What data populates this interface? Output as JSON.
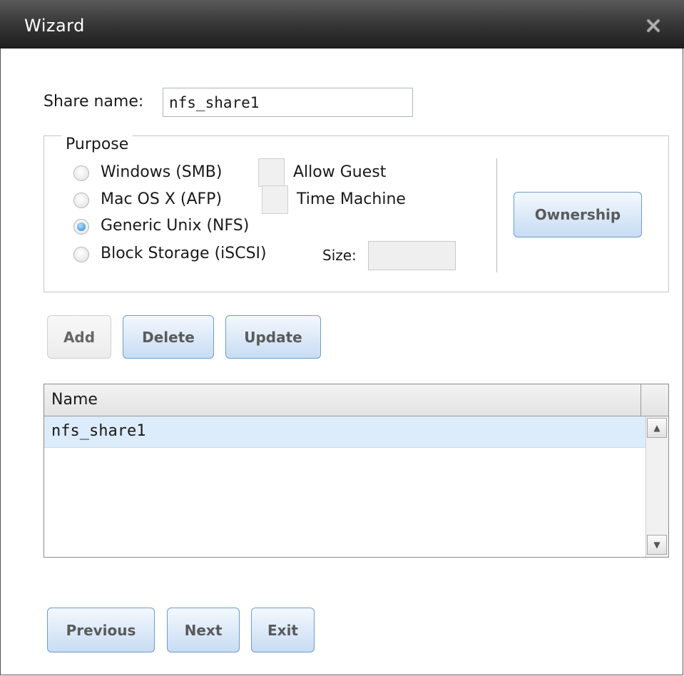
{
  "window": {
    "title": "Wizard",
    "close_icon": "close-x-icon"
  },
  "share": {
    "label": "Share name:",
    "value": "nfs_share1"
  },
  "purpose": {
    "legend": "Purpose",
    "options": [
      {
        "label": "Windows (SMB)",
        "checked": false,
        "extra_label": "Allow Guest"
      },
      {
        "label": "Mac OS X (AFP)",
        "checked": false,
        "extra_label": "Time Machine"
      },
      {
        "label": "Generic Unix (NFS)",
        "checked": true
      },
      {
        "label": "Block Storage (iSCSI)",
        "checked": false,
        "extra_label": "Size:"
      }
    ],
    "size_value": "",
    "ownership_label": "Ownership"
  },
  "actions": {
    "add": "Add",
    "delete": "Delete",
    "update": "Update"
  },
  "grid": {
    "columns": [
      "Name"
    ],
    "rows": [
      {
        "name": "nfs_share1",
        "selected": true
      }
    ]
  },
  "scroll": {
    "up_icon": "arrow-up-icon",
    "down_icon": "arrow-down-icon"
  },
  "nav": {
    "previous": "Previous",
    "next": "Next",
    "exit": "Exit"
  },
  "colors": {
    "accent": "#c8dcf3",
    "selected_row": "#ddecfa",
    "titlebar": "#2e2e2e"
  }
}
